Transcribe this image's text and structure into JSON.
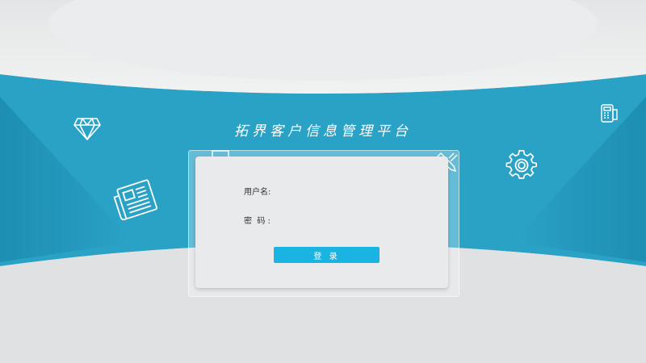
{
  "page_title": "拓界客户信息管理平台",
  "login_form": {
    "username_label": "用户名:",
    "username_value": "",
    "password_label": "密  码 :",
    "password_value": "",
    "login_button_label": "登 录"
  },
  "colors": {
    "band_blue": "#2ca3c7",
    "band_dark": "#1f8fb3",
    "gray_background": "#dfe1e2",
    "button_blue": "#1ab4e2"
  },
  "decorative_icons": [
    "diamond-icon",
    "newspaper-icon",
    "gear-icon",
    "pos-terminal-icon",
    "checklist-icon",
    "pen-icon"
  ]
}
